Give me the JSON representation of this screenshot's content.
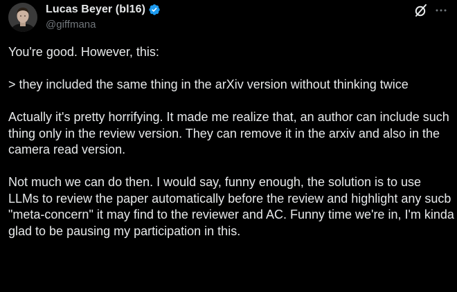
{
  "author": {
    "display_name": "Lucas Beyer (bl16)",
    "handle": "@giffmana",
    "verified": true,
    "verified_color": "#1d9bf0"
  },
  "icons": {
    "verified": "verified-badge-icon",
    "grok": "grok-icon",
    "more": "more-options-icon"
  },
  "tweet": {
    "paragraphs": [
      "You're good. However, this:",
      "> they included the same thing in the arXiv version without thinking twice",
      "Actually it's pretty horrifying. It made me realize that, an author can include such thing only in the review version. They can remove it in the arxiv and also in the camera read version.",
      "Not much we can do then. I would say, funny enough, the solution is to use LLMs to review the paper automatically before the review and highlight any sucb \"meta-concern\" it may find to the reviewer and AC. Funny time we're in, I'm kinda glad to be pausing my participation in this."
    ]
  },
  "colors": {
    "background": "#000000",
    "text": "#e7e9ea",
    "secondary_text": "#71767b"
  }
}
